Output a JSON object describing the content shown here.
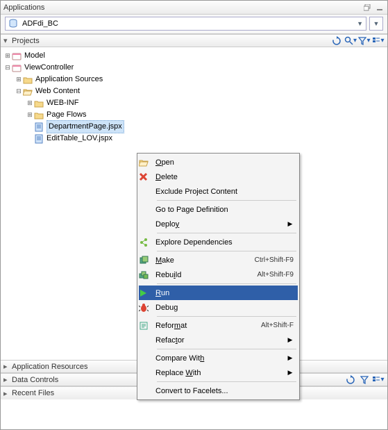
{
  "applications_panel": {
    "title": "Applications",
    "project_selector": "ADFdi_BC"
  },
  "projects_section": {
    "title": "Projects"
  },
  "tree": {
    "model": "Model",
    "viewcontroller": "ViewController",
    "app_sources": "Application Sources",
    "web_content": "Web Content",
    "web_inf": "WEB-INF",
    "page_flows": "Page Flows",
    "dept_page": "DepartmentPage.jspx",
    "edit_table": "EditTable_LOV.jspx"
  },
  "ctx": {
    "open_pre": "",
    "open_u": "O",
    "open_post": "pen",
    "delete_pre": "",
    "delete_u": "D",
    "delete_post": "elete",
    "exclude": "Exclude Project Content",
    "page_def": "Go to Page Definition",
    "deploy_pre": "Deplo",
    "deploy_u": "y",
    "deploy_post": "",
    "explore": "Explore Dependencies",
    "make_pre": "",
    "make_u": "M",
    "make_post": "ake",
    "make_short": "Ctrl+Shift-F9",
    "rebuild_pre": "Rebu",
    "rebuild_u": "i",
    "rebuild_post": "ld",
    "rebuild_short": "Alt+Shift-F9",
    "run_pre": "",
    "run_u": "R",
    "run_post": "un",
    "debug_pre": "Debu",
    "debug_u": "g",
    "debug_post": "",
    "reformat_pre": "Refor",
    "reformat_u": "m",
    "reformat_post": "at",
    "reformat_short": "Alt+Shift-F",
    "refactor_pre": "Refac",
    "refactor_u": "t",
    "refactor_post": "or",
    "compare_pre": "Compare Wit",
    "compare_u": "h",
    "compare_post": "",
    "replace_pre": "Replace ",
    "replace_u": "W",
    "replace_post": "ith",
    "facelets": "Convert to Facelets..."
  },
  "bottom": {
    "app_res": "Application Resources",
    "data_ctrl": "Data Controls",
    "recent": "Recent Files"
  }
}
